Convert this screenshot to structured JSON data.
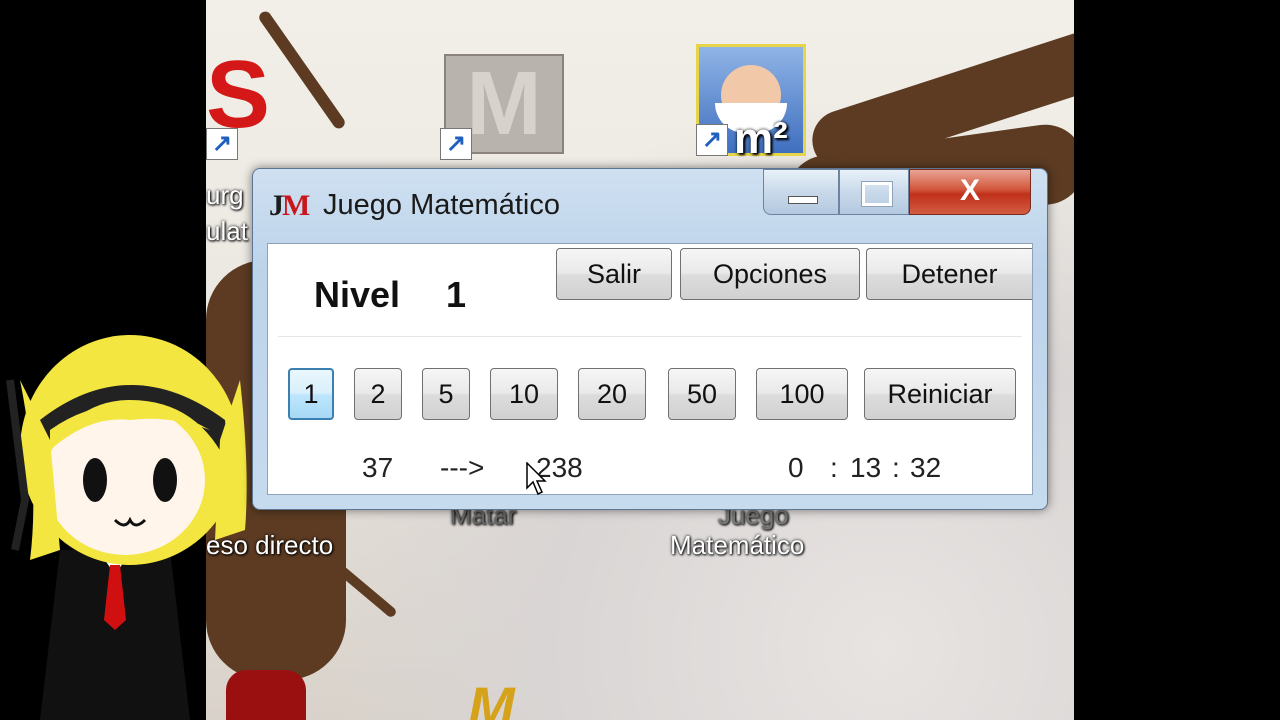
{
  "desktop": {
    "icons": [
      {
        "label_line1": "urg",
        "label_line2": "ulat",
        "label_bottom": "eso directo"
      },
      {
        "label": "Matar"
      },
      {
        "label_top": "Juego",
        "label_bottom": "Matemático"
      }
    ]
  },
  "window": {
    "logo_j": "J",
    "logo_m": "M",
    "title": "Juego Matemático",
    "close_glyph": "X"
  },
  "level": {
    "label": "Nivel",
    "value": "1"
  },
  "actions": {
    "salir": "Salir",
    "opciones": "Opciones",
    "detener": "Detener"
  },
  "denominations": [
    "1",
    "2",
    "5",
    "10",
    "20",
    "50",
    "100"
  ],
  "reset_label": "Reiniciar",
  "status": {
    "current": "37",
    "arrow": "--->",
    "target": "238",
    "timer_h": "0",
    "timer_sep1": ":",
    "timer_m": "13",
    "timer_sep2": ":",
    "timer_s": "32"
  },
  "colors": {
    "close_red": "#c8301a",
    "logo_red": "#c8161b",
    "focus_blue": "#3c7fb1"
  }
}
